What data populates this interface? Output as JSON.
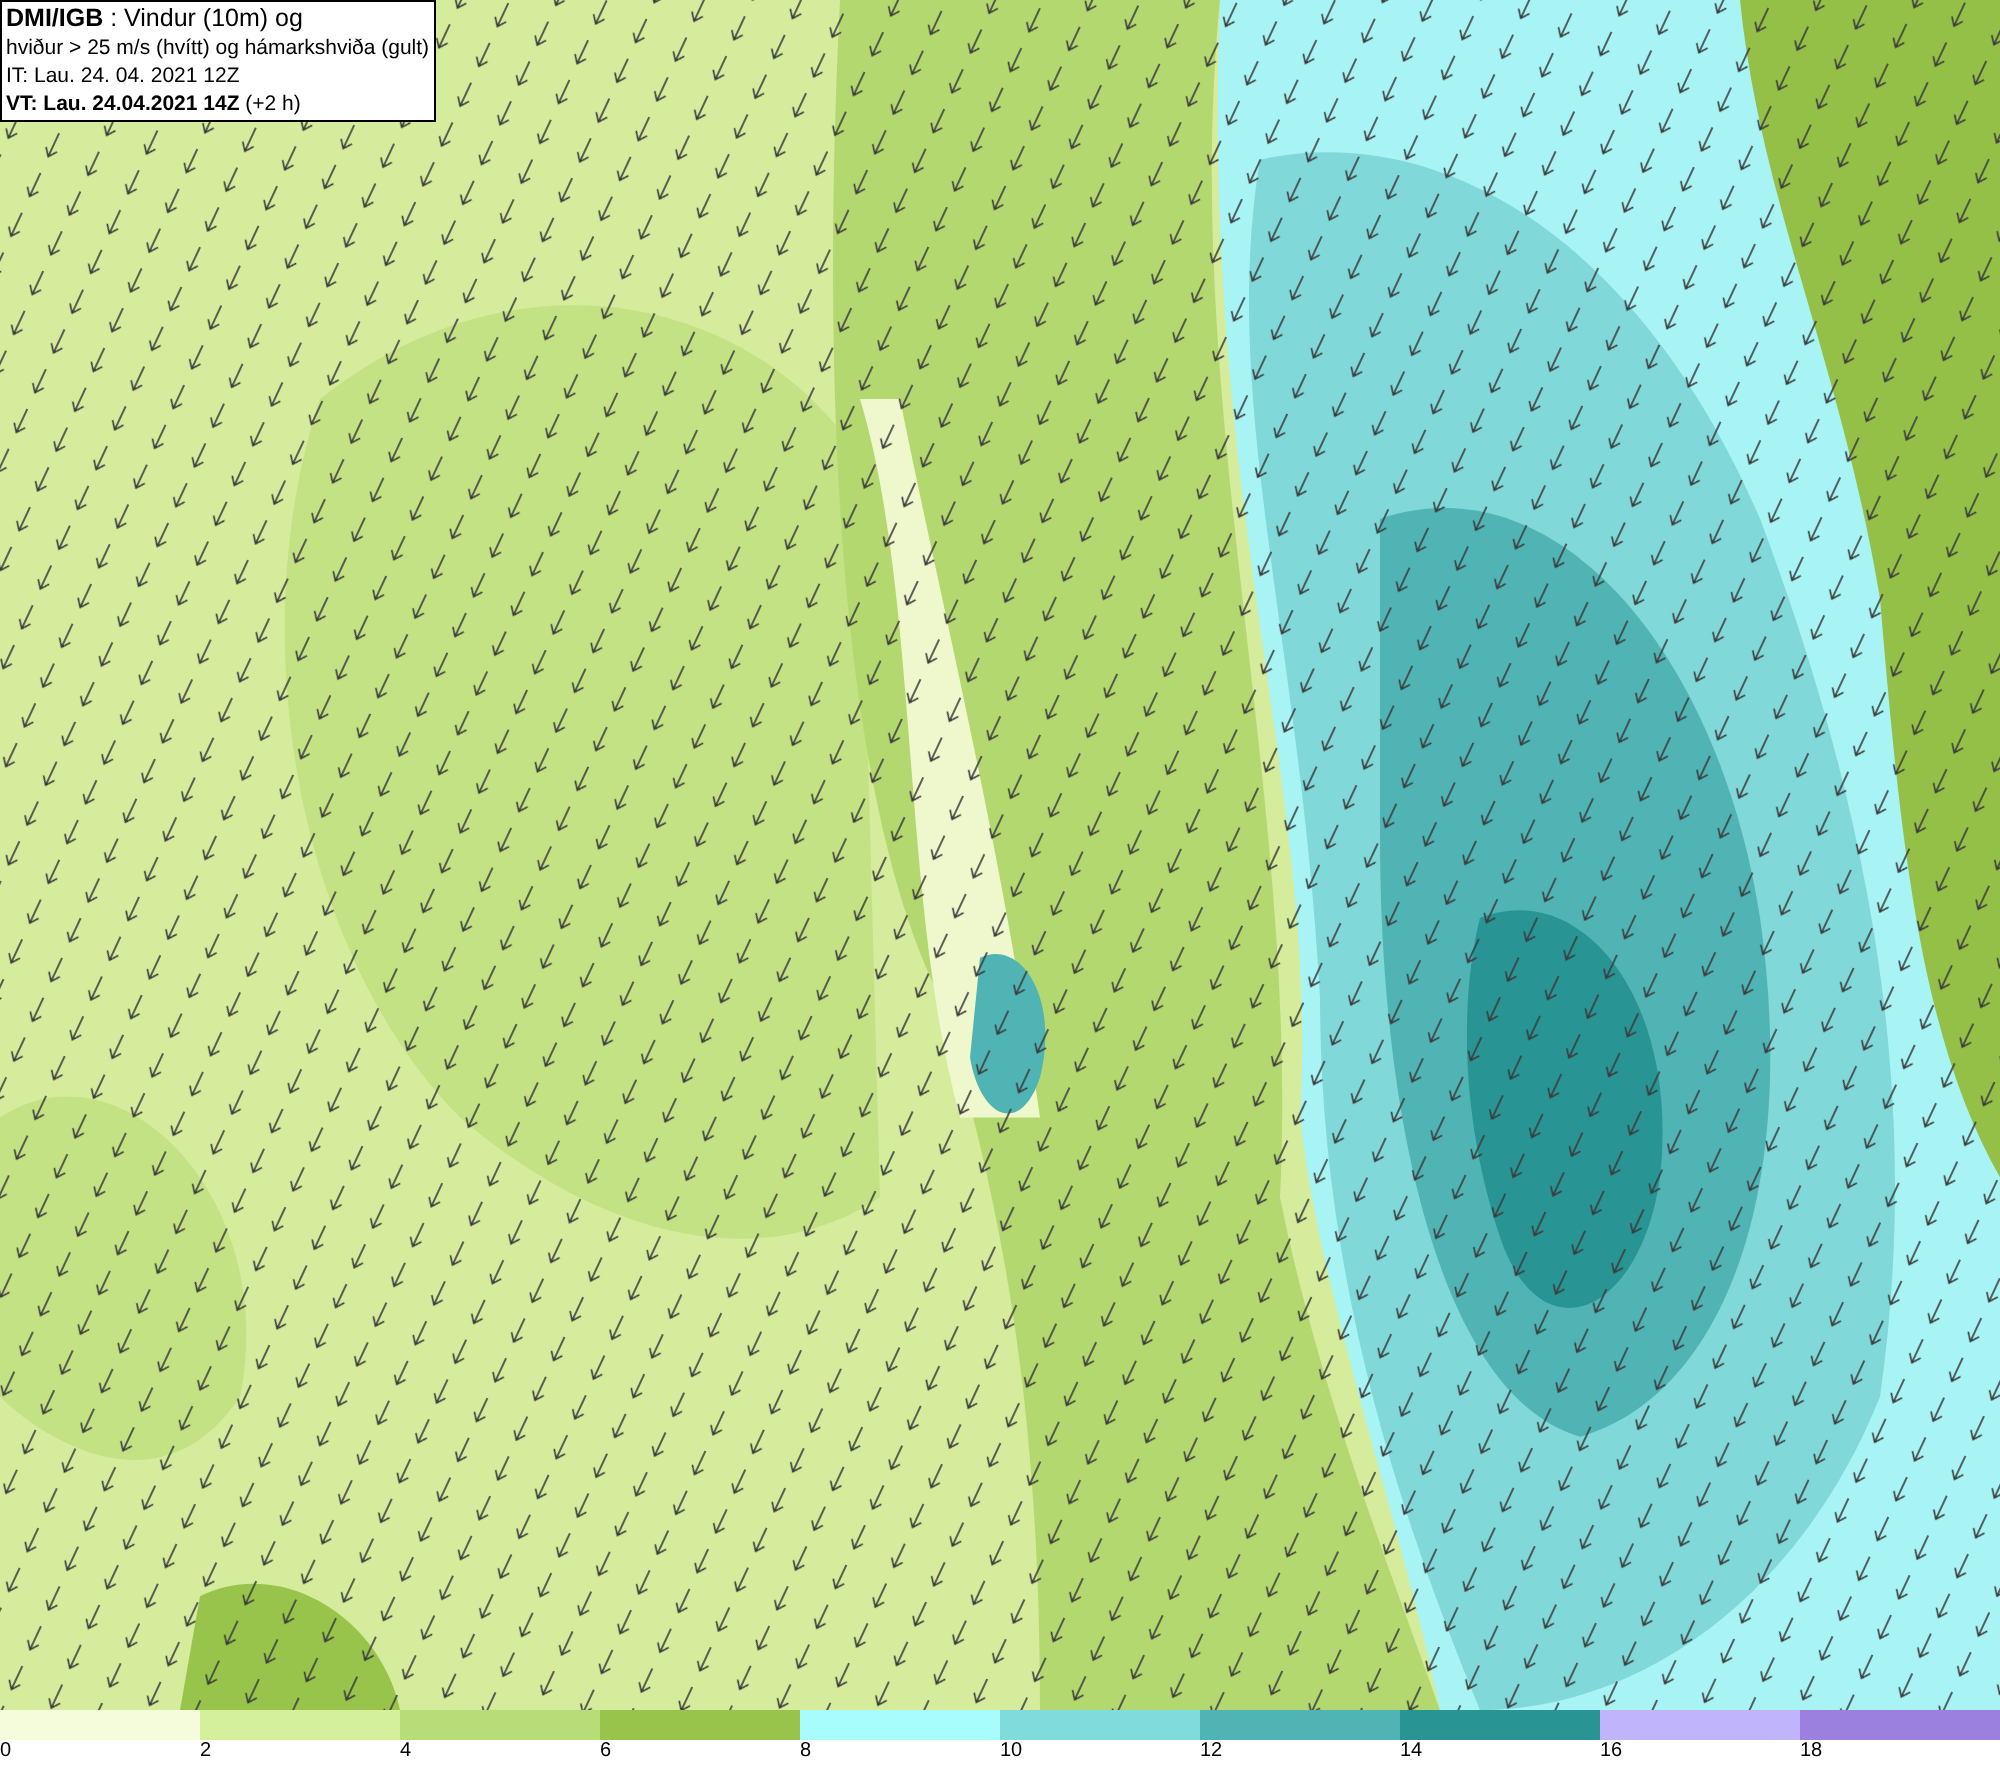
{
  "title_box": {
    "lines": [
      "**DMI/IGB** : Vindur (10m) og",
      "hviður > 25 m/s (hvítt) og hámarkshviða (gult)",
      "IT: Lau. 24. 04. 2021 12Z",
      "**VT: Lau. 24.04.2021 14Z** (+2 h)"
    ]
  },
  "legend": {
    "bins": [
      {
        "color": "#f4fcdc"
      },
      {
        "color": "#d4f09c"
      },
      {
        "color": "#b8dc78"
      },
      {
        "color": "#98c44c"
      },
      {
        "color": "#a8fcfc"
      },
      {
        "color": "#80dcdc"
      },
      {
        "color": "#50b4b4"
      },
      {
        "color": "#289494"
      },
      {
        "color": "#c0b4fc"
      },
      {
        "color": "#9c80e0"
      }
    ],
    "labels": [
      "0",
      "2",
      "4",
      "6",
      "8",
      "10",
      "12",
      "14",
      "16",
      "18"
    ]
  }
}
